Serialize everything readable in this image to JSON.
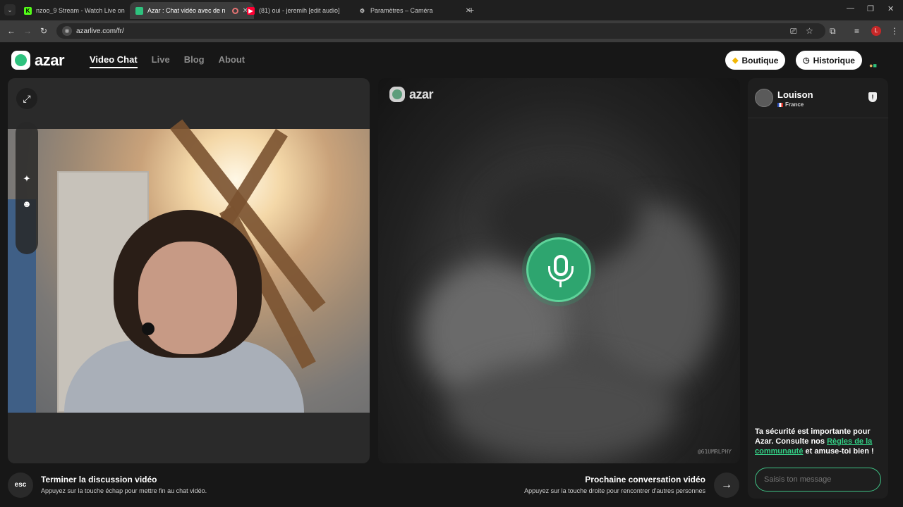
{
  "browser": {
    "tabs": [
      {
        "title": "nzoo_9 Stream - Watch Live on",
        "favicon": "kick-icon",
        "active": false
      },
      {
        "title": "Azar : Chat vidéo avec de n",
        "favicon": "azar-icon",
        "active": true
      },
      {
        "title": "(81) oui - jeremih [edit audio]",
        "favicon": "youtube-icon",
        "active": false
      },
      {
        "title": "Paramètres – Caméra",
        "favicon": "gear-icon",
        "active": false
      }
    ],
    "url": "azarlive.com/fr/",
    "profile_initial": "L"
  },
  "header": {
    "logo_text": "azar",
    "nav": [
      "Video Chat",
      "Live",
      "Blog",
      "About"
    ],
    "active_nav": "Video Chat",
    "boutique_label": "Boutique",
    "historique_label": "Historique"
  },
  "remote_video": {
    "watermark": "azar",
    "tag": "@61UMRLPHY"
  },
  "chat": {
    "peer_name": "Louison",
    "peer_country": "France",
    "safety_part1": "Ta sécurité est importante pour Azar. Consulte nos ",
    "safety_link": "Règles de la communauté",
    "safety_part2": " et amuse-toi bien !",
    "input_placeholder": "Saisis ton message"
  },
  "bottom": {
    "esc_key": "esc",
    "end_title": "Terminer la discussion vidéo",
    "end_sub": "Appuyez sur la touche échap pour mettre fin au chat vidéo.",
    "next_title": "Prochaine conversation vidéo",
    "next_sub": "Appuyez sur la touche droite pour rencontrer d'autres personnes"
  },
  "colors": {
    "accent_green": "#2ea56f",
    "link_green": "#34d086",
    "background": "#171717"
  }
}
